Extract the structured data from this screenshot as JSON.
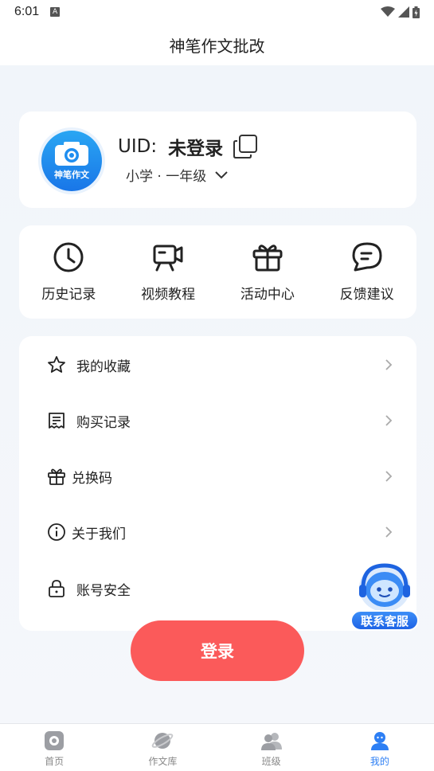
{
  "status_bar": {
    "time": "6:01",
    "notification_icon": "A"
  },
  "header": {
    "title": "神笔作文批改"
  },
  "profile": {
    "avatar_text": "神笔作文",
    "uid_label": "UID:",
    "uid_value": "未登录",
    "grade": "小学 · 一年级"
  },
  "quick_actions": [
    {
      "label": "历史记录",
      "icon": "clock-icon"
    },
    {
      "label": "视频教程",
      "icon": "video-icon"
    },
    {
      "label": "活动中心",
      "icon": "gift-icon"
    },
    {
      "label": "反馈建议",
      "icon": "chat-icon"
    }
  ],
  "menu": [
    {
      "label": "我的收藏",
      "icon": "star-icon"
    },
    {
      "label": "购买记录",
      "icon": "receipt-icon"
    },
    {
      "label": "兑换码",
      "icon": "gift-icon"
    },
    {
      "label": "关于我们",
      "icon": "info-icon"
    },
    {
      "label": "账号安全",
      "icon": "lock-icon"
    }
  ],
  "customer_service": {
    "label": "联系客服"
  },
  "login_button": {
    "label": "登录"
  },
  "tabs": [
    {
      "label": "首页",
      "icon": "home-icon"
    },
    {
      "label": "作文库",
      "icon": "planet-icon"
    },
    {
      "label": "班级",
      "icon": "class-icon"
    },
    {
      "label": "我的",
      "icon": "profile-icon",
      "active": true
    }
  ],
  "colors": {
    "accent": "#2d7ff4",
    "login": "#fb5a5a",
    "background": "#f3f6fa"
  }
}
